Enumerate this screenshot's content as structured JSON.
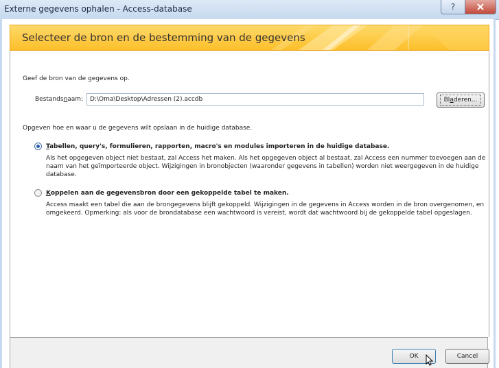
{
  "window": {
    "title": "Externe gegevens ophalen - Access-database",
    "help_label": "?",
    "close_label": "X"
  },
  "banner": {
    "heading": "Selecteer de bron en de bestemming van de gegevens"
  },
  "source": {
    "instruction": "Geef de bron van de gegevens op.",
    "field_label": "Bestandsnaam:",
    "field_value": "D:\\Oma\\Desktop\\Adressen (2).accdb",
    "browse_label": "Bladeren..."
  },
  "destination": {
    "instruction": "Opgeven hoe en waar u de gegevens wilt opslaan in de huidige database."
  },
  "options": [
    {
      "label": "Tabellen, query's, formulieren, rapporten, macro's en modules importeren in de huidige database.",
      "selected": true,
      "description_lines": [
        "Als het opgegeven object niet bestaat, zal Access het maken. Als het opgegeven object al bestaat, zal Access een nummer toevoegen aan de",
        "naam van het geïmporteerde object. Wijzigingen in bronobjecten (waaronder gegevens in tabellen) worden niet weergegeven in de huidige",
        "database."
      ]
    },
    {
      "label": "Koppelen aan de gegevensbron door een gekoppelde tabel te maken.",
      "selected": false,
      "description_lines": [
        "Access maakt een tabel die aan de brongegevens blijft gekoppeld. Wijzigingen in de gegevens in Access worden in de bron overgenomen, en",
        "omgekeerd. Opmerking: als voor de brondatabase een wachtwoord is vereist, wordt dat wachtwoord bij de gekoppelde tabel opgeslagen."
      ]
    }
  ],
  "footer": {
    "ok_label": "OK",
    "cancel_label": "Cancel"
  },
  "colors": {
    "banner": "#fcc83a",
    "titlebar": "#c6d9ef"
  }
}
